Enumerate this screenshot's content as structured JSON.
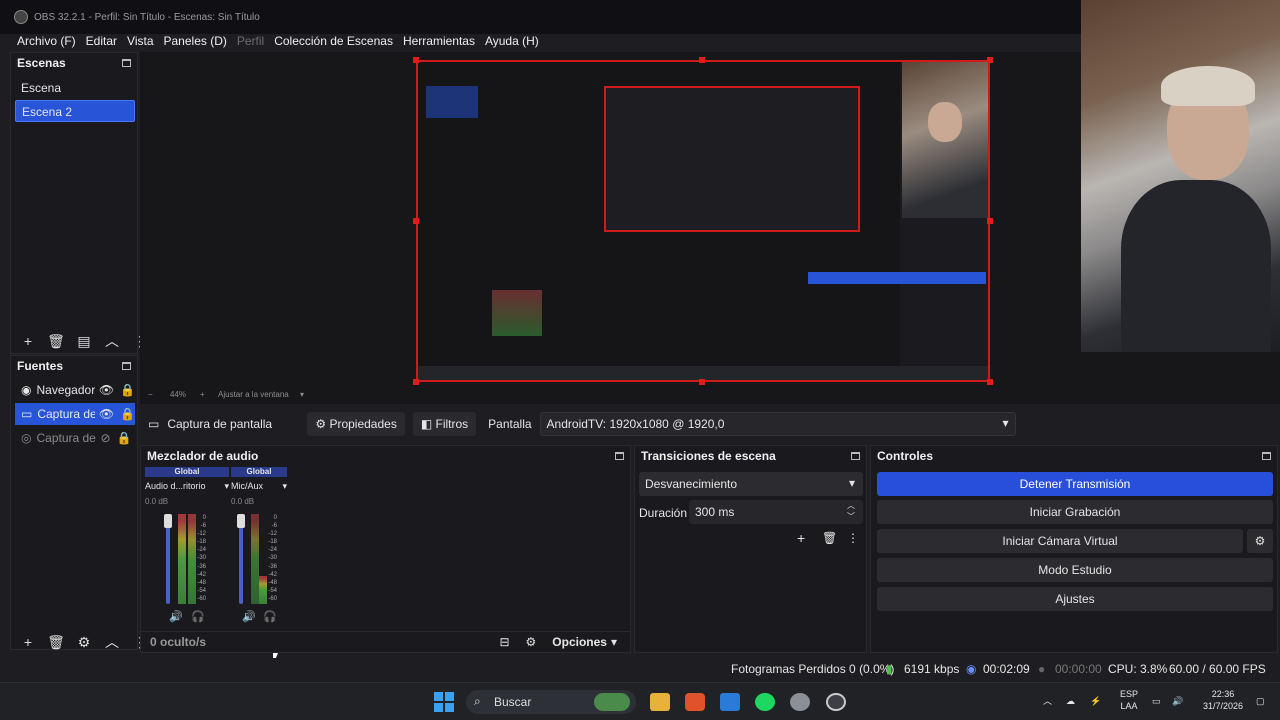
{
  "window": {
    "title": "OBS 32.2.1 - Perfil: Sin Título - Escenas: Sin Título"
  },
  "menu": {
    "items": [
      {
        "label": "Archivo (F)",
        "enabled": true
      },
      {
        "label": "Editar",
        "enabled": true
      },
      {
        "label": "Vista",
        "enabled": true
      },
      {
        "label": "Paneles (D)",
        "enabled": true
      },
      {
        "label": "Perfil",
        "enabled": false
      },
      {
        "label": "Colección de Escenas",
        "enabled": true
      },
      {
        "label": "Herramientas",
        "enabled": true
      },
      {
        "label": "Ayuda (H)",
        "enabled": true
      }
    ]
  },
  "scenes": {
    "title": "Escenas",
    "items": [
      {
        "label": "Escena",
        "selected": false
      },
      {
        "label": "Escena 2",
        "selected": true
      }
    ]
  },
  "sources": {
    "title": "Fuentes",
    "items": [
      {
        "label": "Navegador",
        "icon": "globe-icon",
        "visible": true,
        "selected": false
      },
      {
        "label": "Captura de",
        "icon": "monitor-icon",
        "visible": true,
        "selected": true
      },
      {
        "label": "Captura de",
        "icon": "gamepad-icon",
        "visible": false,
        "selected": false
      }
    ]
  },
  "preview": {
    "zoom": "44%",
    "fit_label": "Ajustar a la ventana"
  },
  "source_toolbar": {
    "source_name": "Captura de pantalla",
    "properties": "Propiedades",
    "filters": "Filtros",
    "display_label": "Pantalla",
    "display_value": "AndroidTV: 1920x1080 @ 1920,0"
  },
  "mixer": {
    "title": "Mezclador de audio",
    "hidden_count": "0 oculto/s",
    "options": "Opciones",
    "channels": [
      {
        "scope": "Global",
        "name": "Audio d...ritorio",
        "db": "0.0 dB"
      },
      {
        "scope": "Global",
        "name": "Mic/Aux",
        "db": "0.0 dB"
      }
    ],
    "scale": [
      "0",
      "-6",
      "-12",
      "-18",
      "-24",
      "-30",
      "-36",
      "-42",
      "-48",
      "-54",
      "-60"
    ]
  },
  "transitions": {
    "title": "Transiciones de escena",
    "selected": "Desvanecimiento",
    "duration_label": "Duración",
    "duration_value": "300 ms"
  },
  "controls": {
    "title": "Controles",
    "stop_stream": "Detener Transmisión",
    "start_recording": "Iniciar Grabación",
    "virtual_cam": "Iniciar Cámara Virtual",
    "studio_mode": "Modo Estudio",
    "settings": "Ajustes"
  },
  "status": {
    "dropped_frames": "Fotogramas Perdidos 0 (0.0%)",
    "bitrate": "6191 kbps",
    "stream_time": "00:02:09",
    "record_time": "00:00:00",
    "cpu": "CPU: 3.8%",
    "fps": "60.00 / 60.00 FPS"
  },
  "taskbar": {
    "search": "Buscar",
    "lang": "ESP",
    "layout": "LAA",
    "time": "22:36",
    "date": "31/7/2026"
  },
  "colors": {
    "accent": "#2854d8",
    "selection_border": "#d11a1a"
  }
}
